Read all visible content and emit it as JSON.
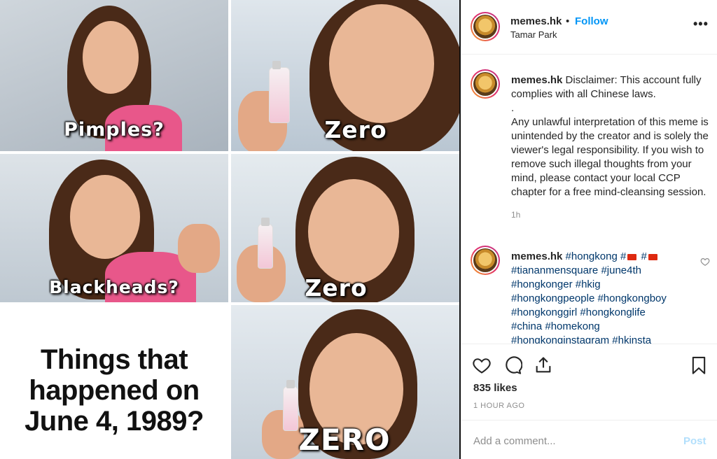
{
  "meme": {
    "captions": {
      "pimples": "Pimples?",
      "zero1": "Zero",
      "blackheads": "Blackheads?",
      "zero2": "Zero",
      "zero3": "ZERO"
    },
    "question_lines": [
      "Things that",
      "happened on",
      "June 4, 1989?"
    ],
    "bottle_label": "ZERO"
  },
  "header": {
    "username": "memes.hk",
    "separator": "•",
    "follow": "Follow",
    "location": "Tamar Park",
    "more": "•••"
  },
  "comments": [
    {
      "username": "memes.hk",
      "text_lines": [
        "Disclaimer: This account fully complies with all Chinese laws.",
        ".",
        "Any unlawful interpretation of this meme is unintended by the creator and is solely the viewer's legal responsibility. If you wish to remove such illegal thoughts from your mind, please contact your local CCP chapter for a free mind-cleansing session."
      ],
      "time": "1h"
    },
    {
      "username": "memes.hk",
      "hashtags": [
        "#hongkong",
        "#",
        "#",
        "#tiananmensquare",
        "#june4th",
        "#hongkonger",
        "#hkig",
        "#hongkongpeople",
        "#hongkongboy",
        "#hongkonggirl",
        "#hongkonglife",
        "#china",
        "#homekong",
        "#hongkonginstagram",
        "#hkinsta"
      ]
    }
  ],
  "actions": {
    "icons": [
      "heart-icon",
      "comment-icon",
      "share-icon",
      "bookmark-icon"
    ],
    "likes": "835 likes",
    "time_ago": "1 HOUR AGO"
  },
  "add_comment": {
    "placeholder": "Add a comment...",
    "post": "Post"
  },
  "colors": {
    "link_blue": "#0095f6",
    "hashtag_blue": "#00376b",
    "post_disabled": "#b2dffc",
    "muted": "#8e8e8e"
  }
}
